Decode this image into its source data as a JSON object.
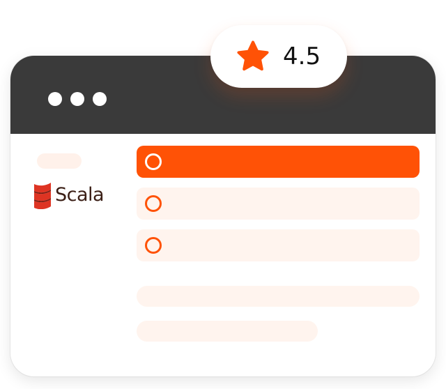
{
  "rating": {
    "icon": "star-icon",
    "value": "4.5",
    "color": "#ff5206"
  },
  "window": {
    "titlebar_color": "#3a3a3a",
    "controls": [
      "dot-icon",
      "dot-icon",
      "dot-icon"
    ]
  },
  "brand": {
    "logo_icon": "scala-logo-icon",
    "name": "Scala",
    "logo_color": "#de3423"
  },
  "options": [
    {
      "label": "",
      "selected": true
    },
    {
      "label": "",
      "selected": false
    },
    {
      "label": "",
      "selected": false
    }
  ],
  "colors": {
    "accent": "#ff5206",
    "placeholder": "#fff4ee"
  }
}
